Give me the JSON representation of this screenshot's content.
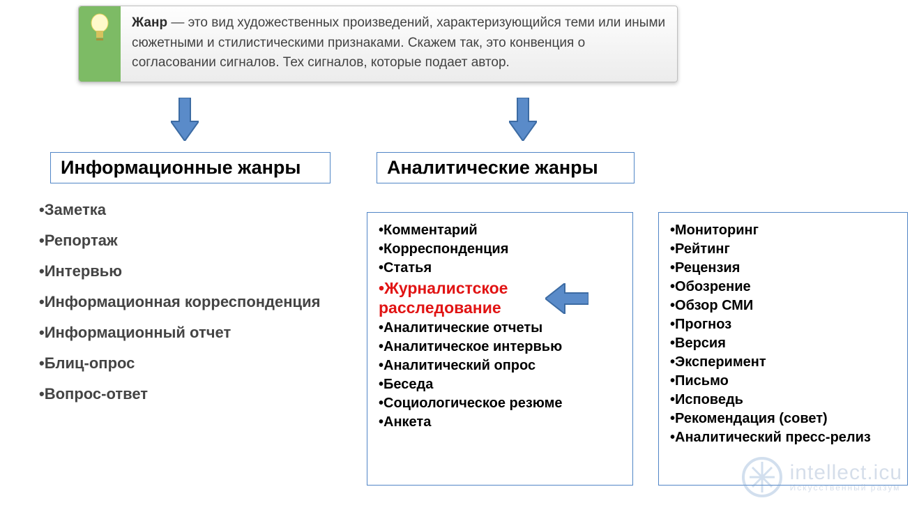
{
  "definition": {
    "term": "Жанр",
    "dash": " — ",
    "body": "это вид художественных произведений, характеризующийся теми или иными сюжетными и стилистическими признаками. Скажем так, это конвенция о согласовании сигналов. Тех сигналов, которые подает автор."
  },
  "categories": {
    "info_title": "Информационные жанры",
    "anal_title": "Аналитические жанры"
  },
  "info_genres": [
    "Заметка",
    "Репортаж",
    "Интервью",
    "Информационная корреспонденция",
    "Информационный отчет",
    "Блиц-опрос",
    "Вопрос-ответ"
  ],
  "anal_col1": [
    "Комментарий",
    "Корреспонденция",
    "Статья"
  ],
  "anal_highlight": "Журналистское расследование",
  "anal_col1b": [
    "Аналитические отчеты",
    "Аналитическое интервью",
    "Аналитический опрос",
    "Беседа",
    "Социологическое резюме",
    "Анкета"
  ],
  "anal_col2": [
    "Мониторинг",
    "Рейтинг",
    "Рецензия",
    "Обозрение",
    "Обзор СМИ",
    "Прогноз",
    "Версия",
    "Эксперимент",
    "Письмо",
    "Исповедь",
    "Рекомендация (совет)",
    "Аналитический пресс-релиз"
  ],
  "watermark": {
    "line1": "intellect.icu",
    "line2": "Искусственный разум"
  }
}
